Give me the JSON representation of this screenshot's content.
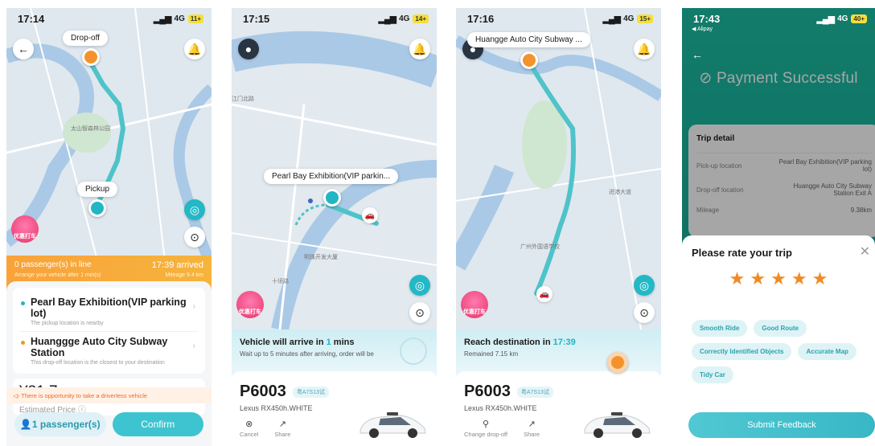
{
  "colors": {
    "teal": "#22b6c4",
    "orange": "#f5922b",
    "route": "#4fc3c9"
  },
  "screen1": {
    "time": "17:14",
    "network": "4G",
    "battery": "11+",
    "dropoff_label": "Drop-off",
    "pickup_label": "Pickup",
    "map_label": "太山智森林公园",
    "promo_label": "优惠打车",
    "queue": "0 passenger(s) in line",
    "queue_sub": "Arrange your vehicle after 1 min(s)",
    "arrival": "17:39 arrived",
    "mileage": "Mileage 9.4 km",
    "pickup_name": "Pearl Bay Exhibition(VIP parking lot)",
    "pickup_desc": "The pickup location is nearby",
    "dropoff_name": "Huanggge Auto City Subway Station",
    "dropoff_desc": "This drop-off location is the closest to your destination",
    "price": "¥31.7",
    "price_label": "Estimated Price",
    "notice": "There is opportunity to take a driverless vehicle",
    "passenger_btn": "1 passenger(s)",
    "confirm_btn": "Confirm"
  },
  "screen2": {
    "time": "17:15",
    "network": "4G",
    "battery": "14+",
    "bubble": "Pearl Bay Exhibition(VIP parkin...",
    "map_label_1": "江门北路",
    "map_label_2": "明珠开发大厦",
    "map_label_3": "十顷路",
    "promo_label": "优惠打车",
    "arrive_prefix": "Vehicle will arrive in ",
    "arrive_value": "1",
    "arrive_suffix": " mins",
    "arrive_sub": "Wait up to 5 minutes after arriving, order will be",
    "plate": "P6003",
    "plate_tag": "粤A7S13试",
    "car_model": "Lexus RX450h.WHITE",
    "cancel": "Cancel",
    "share": "Share"
  },
  "screen3": {
    "time": "17:16",
    "network": "4G",
    "battery": "15+",
    "bubble": "Huangge Auto City Subway ...",
    "map_label_1": "进港大道",
    "map_label_2": "广州外国语学校",
    "promo_label": "优惠打车",
    "reach_prefix": "Reach destination in ",
    "reach_time": "17:39",
    "remained": "Remained 7.15 km",
    "plate": "P6003",
    "plate_tag": "粤A7S13试",
    "car_model": "Lexus RX450h.WHITE",
    "change": "Change drop-off",
    "share": "Share"
  },
  "screen4": {
    "time": "17:43",
    "network": "4G",
    "battery": "40+",
    "alipay": "◀ Alipay",
    "title": "Payment Successful",
    "trip_title": "Trip detail",
    "pickup_label": "Pick-up location",
    "pickup_value": "Pearl Bay Exhibition(VIP parking lot)",
    "dropoff_label": "Drop-off location",
    "dropoff_value": "Huangge Auto City Subway Station Exit A",
    "mileage_label": "Mileage",
    "mileage_value": "9.38km",
    "rate_title": "Please rate your trip",
    "rating": 5,
    "tags": [
      "Smooth Ride",
      "Good Route",
      "Correctly Identified Objects",
      "Accurate Map",
      "Tidy Car"
    ],
    "submit": "Submit Feedback"
  }
}
